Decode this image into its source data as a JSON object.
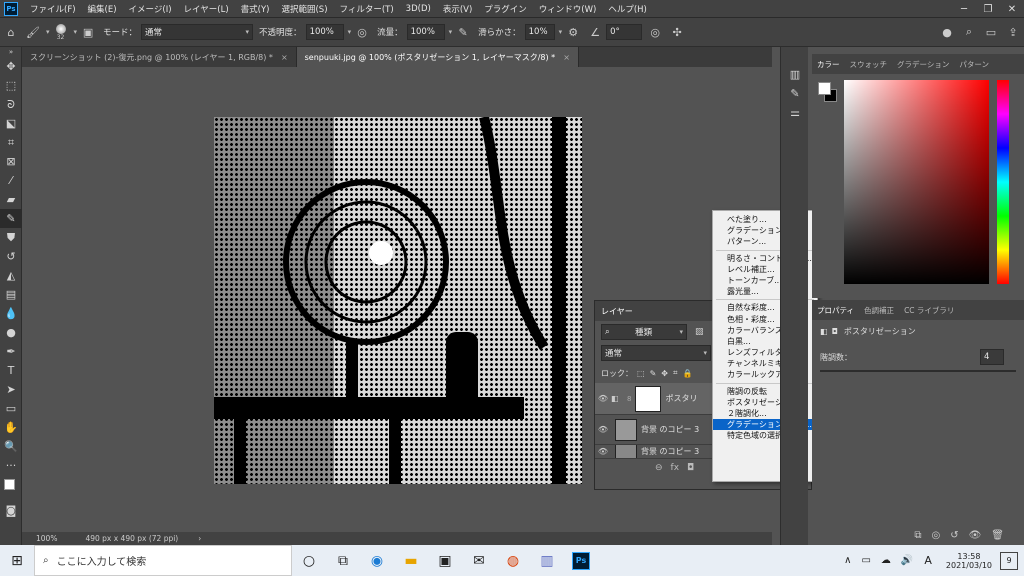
{
  "app": {
    "logo": "Ps"
  },
  "menu": [
    "ファイル(F)",
    "編集(E)",
    "イメージ(I)",
    "レイヤー(L)",
    "書式(Y)",
    "選択範囲(S)",
    "フィルター(T)",
    "3D(D)",
    "表示(V)",
    "プラグイン",
    "ウィンドウ(W)",
    "ヘルプ(H)"
  ],
  "options": {
    "brush_size": "32",
    "mode_label": "モード：",
    "mode_value": "通常",
    "opacity_label": "不透明度：",
    "opacity_value": "100%",
    "flow_label": "流量：",
    "flow_value": "100%",
    "smooth_label": "滑らかさ：",
    "smooth_value": "10%",
    "angle_value": "0°"
  },
  "tabs": [
    {
      "label": "スクリーンショット (2)-復元.png @ 100% (レイヤー 1, RGB/8) *",
      "close": "×"
    },
    {
      "label": "senpuuki.jpg @ 100% (ポスタリゼーション 1, レイヤーマスク/8) *",
      "close": "×"
    }
  ],
  "status": {
    "zoom": "100%",
    "doc_info": "490 px x 490 px (72 ppi)"
  },
  "layers": {
    "title": "レイヤー",
    "filter_label": "種類",
    "blend_mode": "通常",
    "lock_label": "ロック：",
    "rows": [
      {
        "name": "ポスタリ"
      },
      {
        "name": "背景 のコピー 3"
      },
      {
        "name": "背景 のコピー 3"
      }
    ]
  },
  "adjust_menu": {
    "groups": [
      [
        "べた塗り...",
        "グラデーション...",
        "パターン..."
      ],
      [
        "明るさ・コントラスト...",
        "レベル補正...",
        "トーンカーブ...",
        "露光量..."
      ],
      [
        "自然な彩度...",
        "色相・彩度...",
        "カラーバランス...",
        "白黒...",
        "レンズフィルター...",
        "チャンネルミキサー...",
        "カラールックアップ..."
      ],
      [
        "階調の反転",
        "ポスタリゼーション...",
        "２階調化...",
        "グラデーションマップ...",
        "特定色域の選択..."
      ]
    ],
    "highlighted": "グラデーションマップ..."
  },
  "color_panel": {
    "tabs": [
      "カラー",
      "スウォッチ",
      "グラデーション",
      "パターン"
    ]
  },
  "props_panel": {
    "tabs": [
      "プロパティ",
      "色調補正",
      "CC ライブラリ"
    ],
    "subtitle": "ポスタリゼーション",
    "levels_label": "階調数：",
    "levels_value": "4"
  },
  "taskbar": {
    "search_placeholder": "ここに入力して検索",
    "time": "13:58",
    "date": "2021/03/10",
    "ime": "A",
    "notifications": "9"
  },
  "colors": {
    "accent": "#0a64c8",
    "ps_blue": "#31a8ff"
  }
}
